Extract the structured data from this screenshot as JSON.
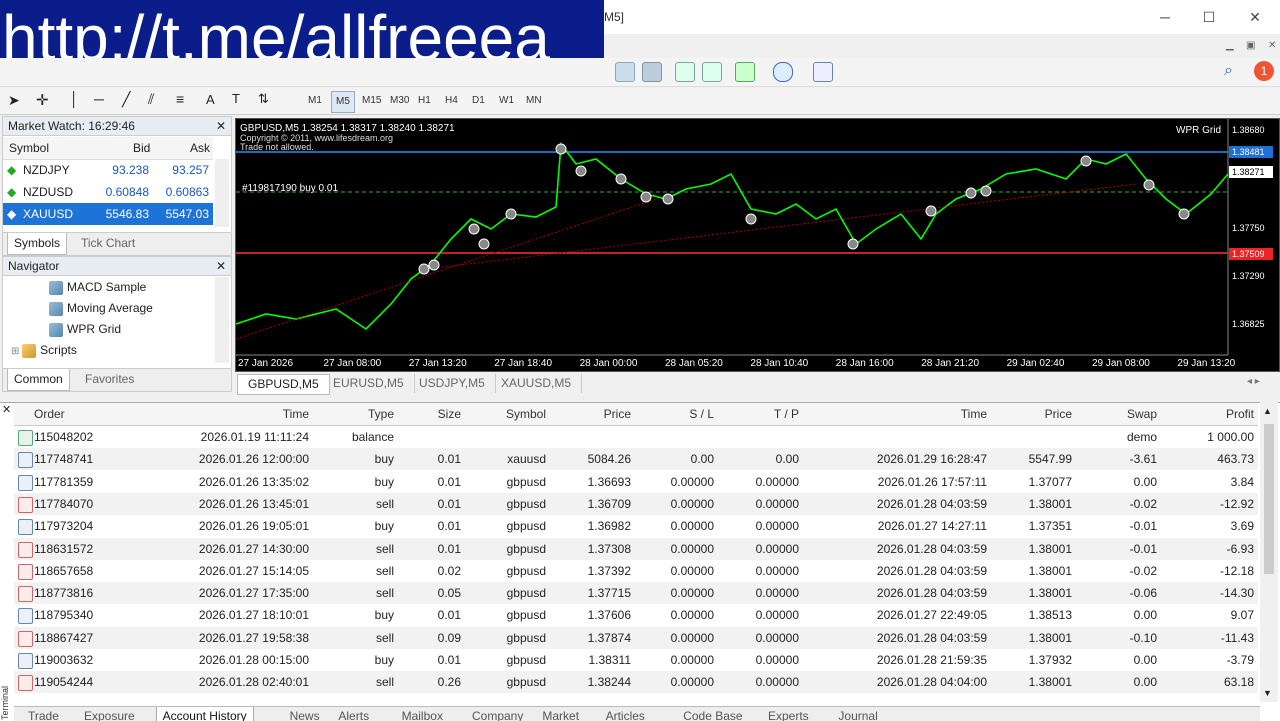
{
  "watermark": "http://t.me/allfreeea",
  "window": {
    "title_suffix": "M5]",
    "min": "─",
    "max": "☐",
    "close": "✕"
  },
  "notification_count": "1",
  "timeframes": [
    "M1",
    "M5",
    "M15",
    "M30",
    "H1",
    "H4",
    "D1",
    "W1",
    "MN"
  ],
  "active_timeframe": "M5",
  "market_watch": {
    "title": "Market Watch: 16:29:46",
    "headers": {
      "symbol": "Symbol",
      "bid": "Bid",
      "ask": "Ask"
    },
    "rows": [
      {
        "symbol": "NZDJPY",
        "bid": "93.238",
        "ask": "93.257",
        "selected": false
      },
      {
        "symbol": "NZDUSD",
        "bid": "0.60848",
        "ask": "0.60863",
        "selected": false
      },
      {
        "symbol": "XAUUSD",
        "bid": "5546.83",
        "ask": "5547.03",
        "selected": true
      }
    ],
    "tabs": [
      "Symbols",
      "Tick Chart"
    ]
  },
  "navigator": {
    "title": "Navigator",
    "items": [
      "MACD Sample",
      "Moving Average",
      "WPR Grid",
      "Scripts"
    ],
    "tabs": [
      "Common",
      "Favorites"
    ]
  },
  "chart": {
    "header": "GBPUSD,M5  1.38254 1.38317 1.38240 1.38271",
    "copyright": "Copyright © 2011, www.lifesdream.org",
    "trade_status": "Trade not allowed.",
    "ea_name": "WPR Grid",
    "order_label": "#119817190 buy 0.01",
    "price_labels": [
      "1.38680",
      "1.38481",
      "1.38271",
      "1.37750",
      "1.37509",
      "1.37290",
      "1.36825"
    ],
    "time_labels": [
      "27 Jan 2026",
      "27 Jan 08:00",
      "27 Jan 13:20",
      "27 Jan 18:40",
      "28 Jan 00:00",
      "28 Jan 05:20",
      "28 Jan 10:40",
      "28 Jan 16:00",
      "28 Jan 21:20",
      "29 Jan 02:40",
      "29 Jan 08:00",
      "29 Jan 13:20"
    ],
    "colors": {
      "background": "#000000",
      "candles": "#00ff00",
      "tp_line": "#1e90ff",
      "sl_line": "#ff3030"
    }
  },
  "chart_tabs": [
    "GBPUSD,M5",
    "EURUSD,M5",
    "USDJPY,M5",
    "XAUUSD,M5"
  ],
  "history": {
    "headers": {
      "order": "Order",
      "time": "Time",
      "type": "Type",
      "size": "Size",
      "symbol": "Symbol",
      "price": "Price",
      "sl": "S / L",
      "tp": "T / P",
      "time2": "Time",
      "price2": "Price",
      "swap": "Swap",
      "profit": "Profit"
    },
    "rows": [
      {
        "order": "115048202",
        "time": "2026.01.19 11:11:24",
        "type": "balance",
        "size": "",
        "symbol": "",
        "price": "",
        "sl": "",
        "tp": "",
        "time2": "",
        "price2": "",
        "swap": "demo",
        "profit": "1 000.00"
      },
      {
        "order": "117748741",
        "time": "2026.01.26 12:00:00",
        "type": "buy",
        "size": "0.01",
        "symbol": "xauusd",
        "price": "5084.26",
        "sl": "0.00",
        "tp": "0.00",
        "time2": "2026.01.29 16:28:47",
        "price2": "5547.99",
        "swap": "-3.61",
        "profit": "463.73"
      },
      {
        "order": "117781359",
        "time": "2026.01.26 13:35:02",
        "type": "buy",
        "size": "0.01",
        "symbol": "gbpusd",
        "price": "1.36693",
        "sl": "0.00000",
        "tp": "0.00000",
        "time2": "2026.01.26 17:57:11",
        "price2": "1.37077",
        "swap": "0.00",
        "profit": "3.84"
      },
      {
        "order": "117784070",
        "time": "2026.01.26 13:45:01",
        "type": "sell",
        "size": "0.01",
        "symbol": "gbpusd",
        "price": "1.36709",
        "sl": "0.00000",
        "tp": "0.00000",
        "time2": "2026.01.28 04:03:59",
        "price2": "1.38001",
        "swap": "-0.02",
        "profit": "-12.92"
      },
      {
        "order": "117973204",
        "time": "2026.01.26 19:05:01",
        "type": "buy",
        "size": "0.01",
        "symbol": "gbpusd",
        "price": "1.36982",
        "sl": "0.00000",
        "tp": "0.00000",
        "time2": "2026.01.27 14:27:11",
        "price2": "1.37351",
        "swap": "-0.01",
        "profit": "3.69"
      },
      {
        "order": "118631572",
        "time": "2026.01.27 14:30:00",
        "type": "sell",
        "size": "0.01",
        "symbol": "gbpusd",
        "price": "1.37308",
        "sl": "0.00000",
        "tp": "0.00000",
        "time2": "2026.01.28 04:03:59",
        "price2": "1.38001",
        "swap": "-0.01",
        "profit": "-6.93"
      },
      {
        "order": "118657658",
        "time": "2026.01.27 15:14:05",
        "type": "sell",
        "size": "0.02",
        "symbol": "gbpusd",
        "price": "1.37392",
        "sl": "0.00000",
        "tp": "0.00000",
        "time2": "2026.01.28 04:03:59",
        "price2": "1.38001",
        "swap": "-0.02",
        "profit": "-12.18"
      },
      {
        "order": "118773816",
        "time": "2026.01.27 17:35:00",
        "type": "sell",
        "size": "0.05",
        "symbol": "gbpusd",
        "price": "1.37715",
        "sl": "0.00000",
        "tp": "0.00000",
        "time2": "2026.01.28 04:03:59",
        "price2": "1.38001",
        "swap": "-0.06",
        "profit": "-14.30"
      },
      {
        "order": "118795340",
        "time": "2026.01.27 18:10:01",
        "type": "buy",
        "size": "0.01",
        "symbol": "gbpusd",
        "price": "1.37606",
        "sl": "0.00000",
        "tp": "0.00000",
        "time2": "2026.01.27 22:49:05",
        "price2": "1.38513",
        "swap": "0.00",
        "profit": "9.07"
      },
      {
        "order": "118867427",
        "time": "2026.01.27 19:58:38",
        "type": "sell",
        "size": "0.09",
        "symbol": "gbpusd",
        "price": "1.37874",
        "sl": "0.00000",
        "tp": "0.00000",
        "time2": "2026.01.28 04:03:59",
        "price2": "1.38001",
        "swap": "-0.10",
        "profit": "-11.43"
      },
      {
        "order": "119003632",
        "time": "2026.01.28 00:15:00",
        "type": "buy",
        "size": "0.01",
        "symbol": "gbpusd",
        "price": "1.38311",
        "sl": "0.00000",
        "tp": "0.00000",
        "time2": "2026.01.28 21:59:35",
        "price2": "1.37932",
        "swap": "0.00",
        "profit": "-3.79"
      },
      {
        "order": "119054244",
        "time": "2026.01.28 02:40:01",
        "type": "sell",
        "size": "0.26",
        "symbol": "gbpusd",
        "price": "1.38244",
        "sl": "0.00000",
        "tp": "0.00000",
        "time2": "2026.01.28 04:04:00",
        "price2": "1.38001",
        "swap": "0.00",
        "profit": "63.18"
      }
    ]
  },
  "terminal_tabs": [
    "Trade",
    "Exposure",
    "Account History",
    "News",
    "Alerts",
    "Mailbox",
    "Company",
    "Market",
    "Articles",
    "Code Base",
    "Experts",
    "Journal"
  ],
  "active_terminal_tab": "Account History",
  "terminal_label": "Terminal"
}
